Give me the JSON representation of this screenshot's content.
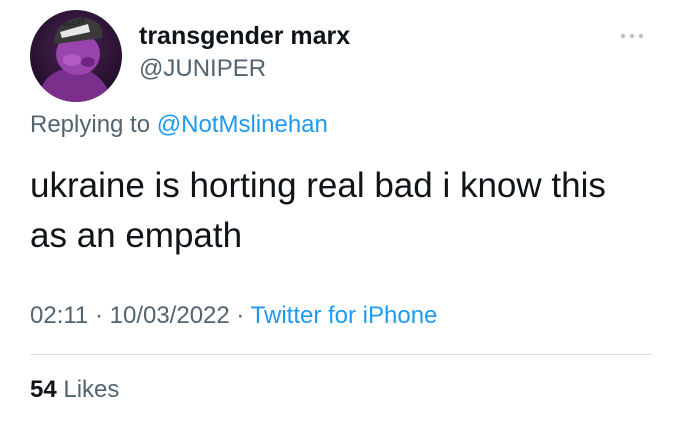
{
  "author": {
    "display_name": "transgender marx",
    "handle": "@JUNIPER",
    "avatar_badge_text": "PRESS"
  },
  "more_icon": "ellipsis-horizontal-icon",
  "reply_context": {
    "prefix": "Replying to",
    "mention": "@NotMslinehan"
  },
  "tweet": {
    "text": "ukraine is horting real bad i know this as an empath"
  },
  "meta": {
    "time": "02:11",
    "separator": "·",
    "date": "10/03/2022",
    "source": "Twitter for iPhone"
  },
  "engagement": {
    "likes_count": "54",
    "likes_label": "Likes"
  },
  "colors": {
    "text_primary": "#0f1419",
    "text_secondary": "#536471",
    "link": "#1d9bf0",
    "divider": "#dcdfe2",
    "avatar_background": "#2a1230",
    "avatar_figure": "#8a3a9c"
  }
}
